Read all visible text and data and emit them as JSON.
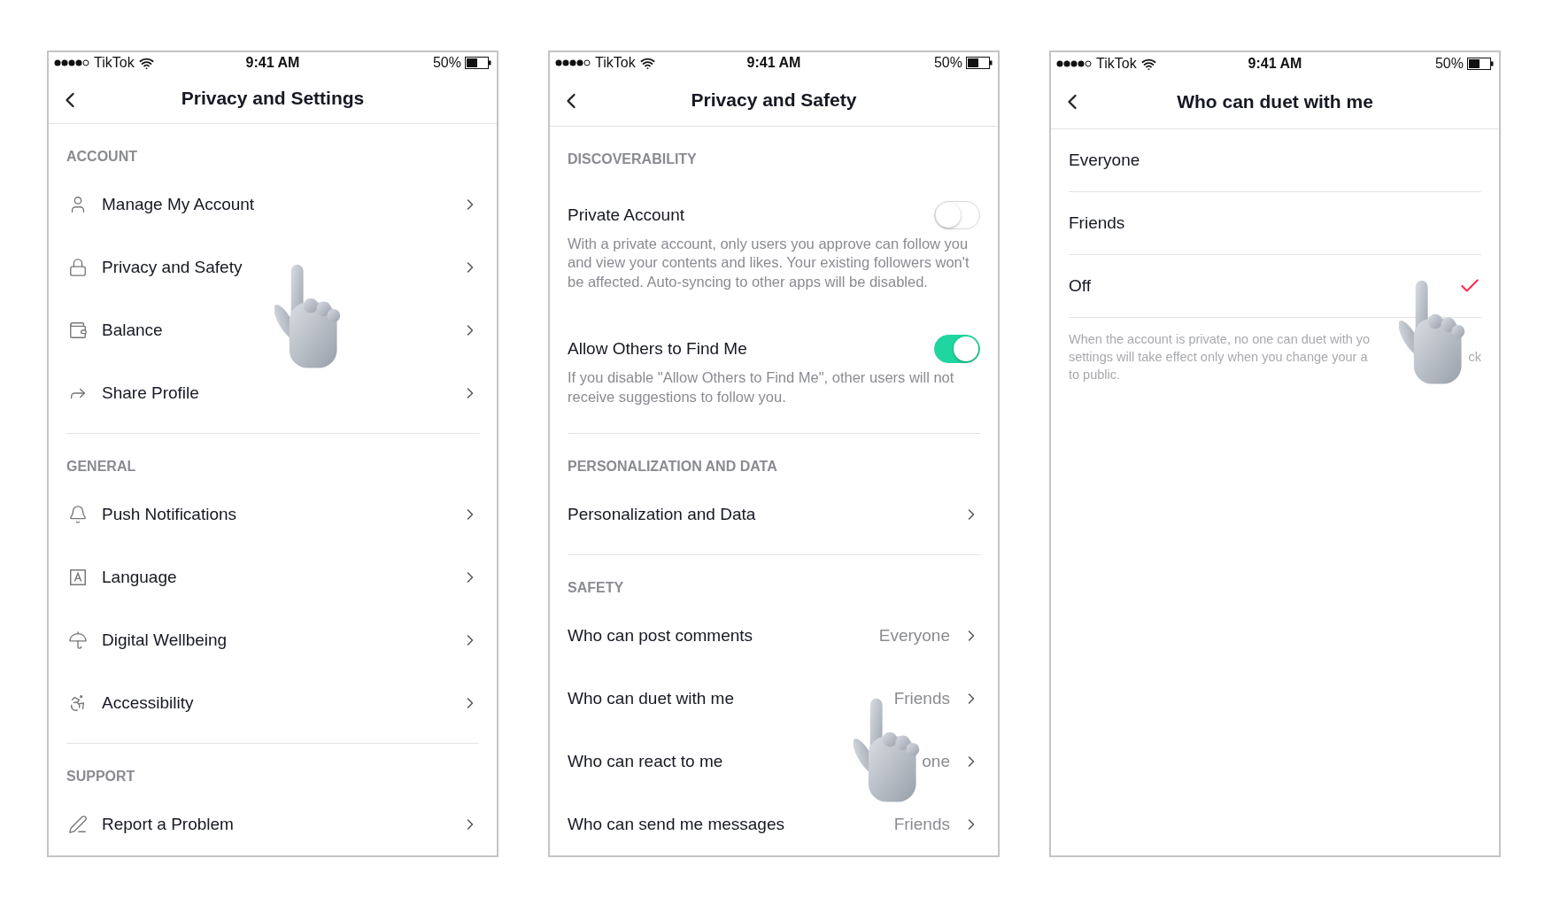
{
  "screens": [
    {
      "status_bar": {
        "carrier": "TikTok",
        "time": "9:41 AM",
        "battery": "50%"
      },
      "title": "Privacy and Settings",
      "sections": [
        {
          "heading": "ACCOUNT",
          "items": [
            {
              "kind": "link",
              "label": "Manage My Account"
            },
            {
              "kind": "link",
              "label": "Privacy and Safety"
            },
            {
              "kind": "link",
              "label": "Balance"
            },
            {
              "kind": "link",
              "label": "Share Profile"
            }
          ]
        },
        {
          "heading": "GENERAL",
          "items": [
            {
              "kind": "link",
              "label": "Push Notifications"
            },
            {
              "kind": "link",
              "label": "Language"
            },
            {
              "kind": "link",
              "label": "Digital Wellbeing"
            },
            {
              "kind": "link",
              "label": "Accessibility"
            }
          ]
        },
        {
          "heading": "SUPPORT",
          "items": [
            {
              "kind": "link",
              "label": "Report a Problem"
            }
          ]
        }
      ]
    },
    {
      "status_bar": {
        "carrier": "TikTok",
        "time": "9:41 AM",
        "battery": "50%"
      },
      "title": "Privacy and Safety",
      "sections": [
        {
          "heading": "DISCOVERABILITY",
          "items": [
            {
              "kind": "toggle",
              "label": "Private Account",
              "on": false,
              "description": "With a private account, only users you approve can follow you and view your contents and likes. Your existing followers won't be affected. Auto-syncing to other apps will be disabled."
            },
            {
              "kind": "toggle",
              "label": "Allow Others to Find Me",
              "on": true,
              "description": "If you disable \"Allow Others to Find Me\", other users will not receive suggestions to follow you."
            }
          ]
        },
        {
          "heading": "PERSONALIZATION AND DATA",
          "items": [
            {
              "kind": "link",
              "label": "Personalization and Data"
            }
          ]
        },
        {
          "heading": "SAFETY",
          "items": [
            {
              "kind": "link",
              "label": "Who can post comments",
              "value": "Everyone"
            },
            {
              "kind": "link",
              "label": "Who can duet with me",
              "value": "Friends"
            },
            {
              "kind": "link",
              "label": "Who can react to me",
              "value": "one"
            },
            {
              "kind": "link",
              "label": "Who can send me messages",
              "value": "Friends"
            }
          ]
        }
      ]
    },
    {
      "status_bar": {
        "carrier": "TikTok",
        "time": "9:41 AM",
        "battery": "50%"
      },
      "title": "Who can duet with me",
      "options": [
        {
          "label": "Everyone",
          "selected": false
        },
        {
          "label": "Friends",
          "selected": false
        },
        {
          "label": "Off",
          "selected": true
        }
      ],
      "footnote_lines": [
        [
          "When the account is private, no one can duet with yo"
        ],
        [
          "settings will take effect only when you change your a",
          "ck"
        ],
        [
          "to public."
        ]
      ]
    }
  ]
}
